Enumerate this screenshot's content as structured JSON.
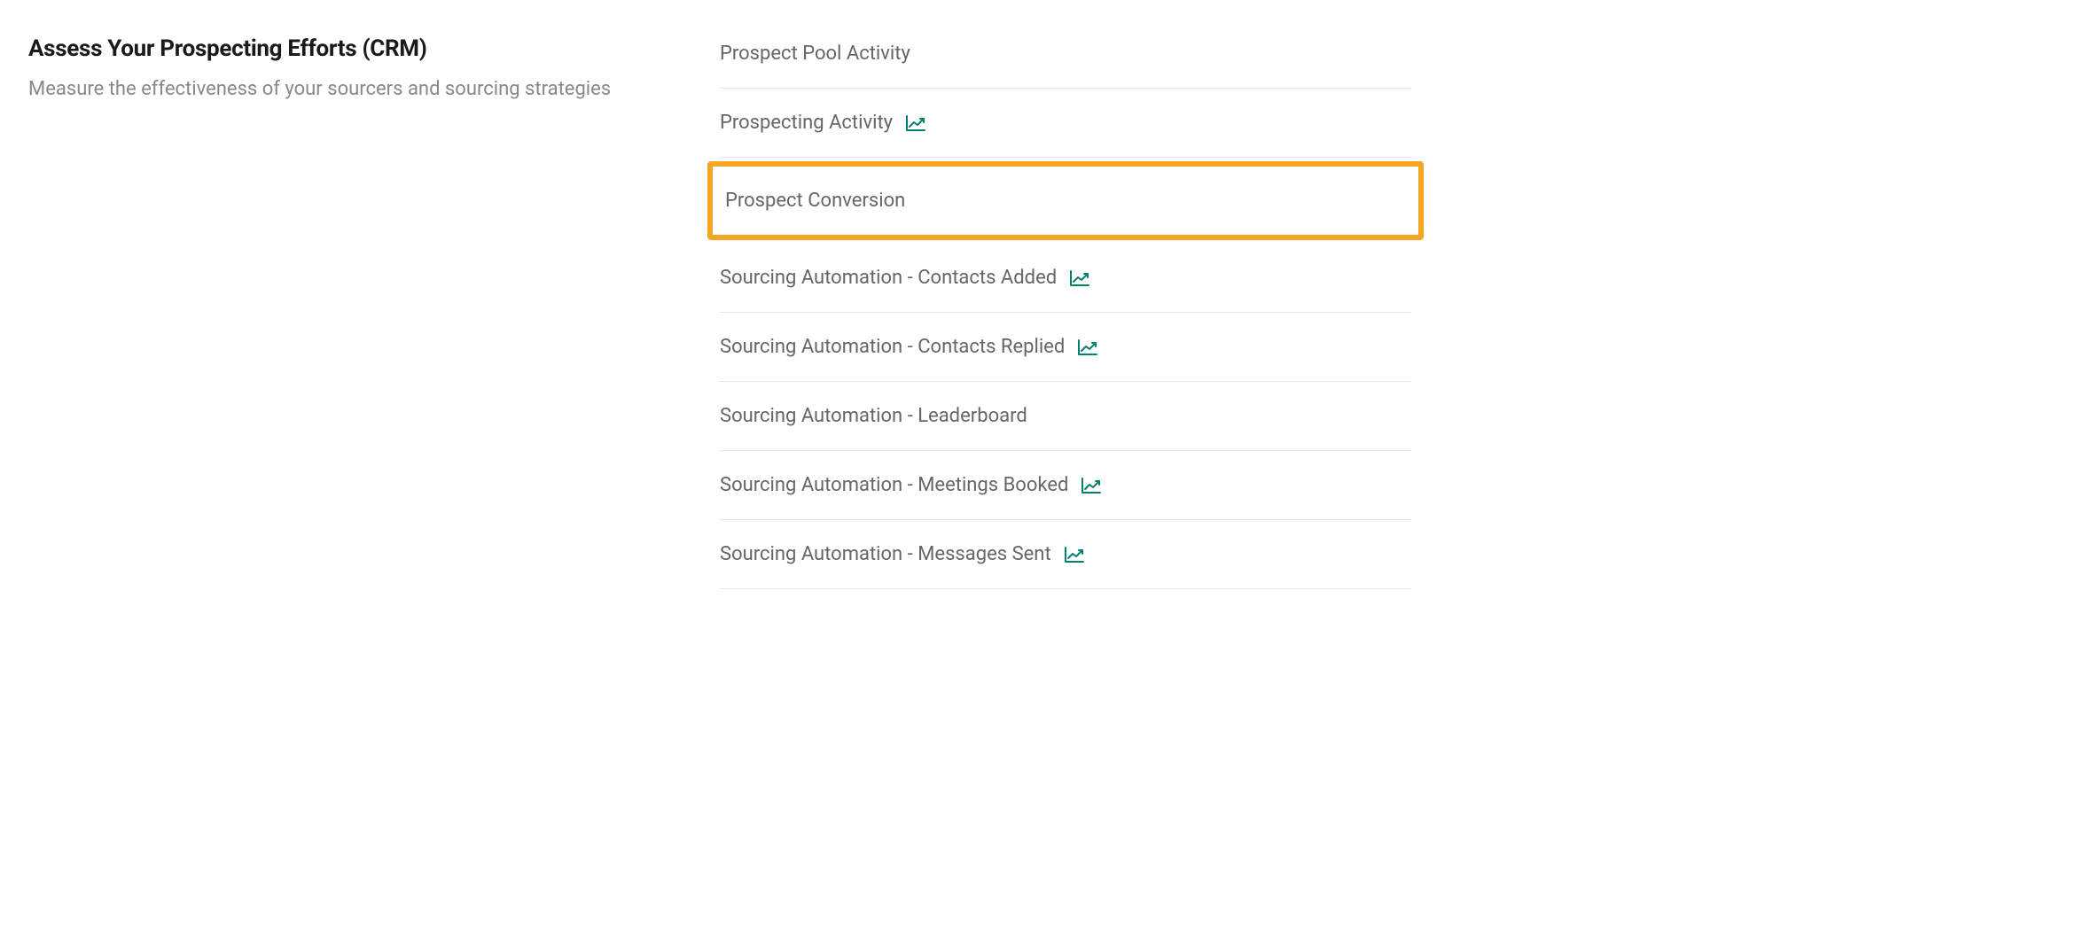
{
  "section": {
    "title": "Assess Your Prospecting Efforts (CRM)",
    "subtitle": "Measure the effectiveness of your sourcers and sourcing strategies"
  },
  "reports": [
    {
      "label": "Prospect Pool Activity",
      "hasChart": false,
      "highlighted": false
    },
    {
      "label": "Prospecting Activity",
      "hasChart": true,
      "highlighted": false
    },
    {
      "label": "Prospect Conversion",
      "hasChart": false,
      "highlighted": true
    },
    {
      "label": "Sourcing Automation - Contacts Added",
      "hasChart": true,
      "highlighted": false
    },
    {
      "label": "Sourcing Automation - Contacts Replied",
      "hasChart": true,
      "highlighted": false
    },
    {
      "label": "Sourcing Automation - Leaderboard",
      "hasChart": false,
      "highlighted": false
    },
    {
      "label": "Sourcing Automation - Meetings Booked",
      "hasChart": true,
      "highlighted": false
    },
    {
      "label": "Sourcing Automation - Messages Sent",
      "hasChart": true,
      "highlighted": false
    }
  ]
}
